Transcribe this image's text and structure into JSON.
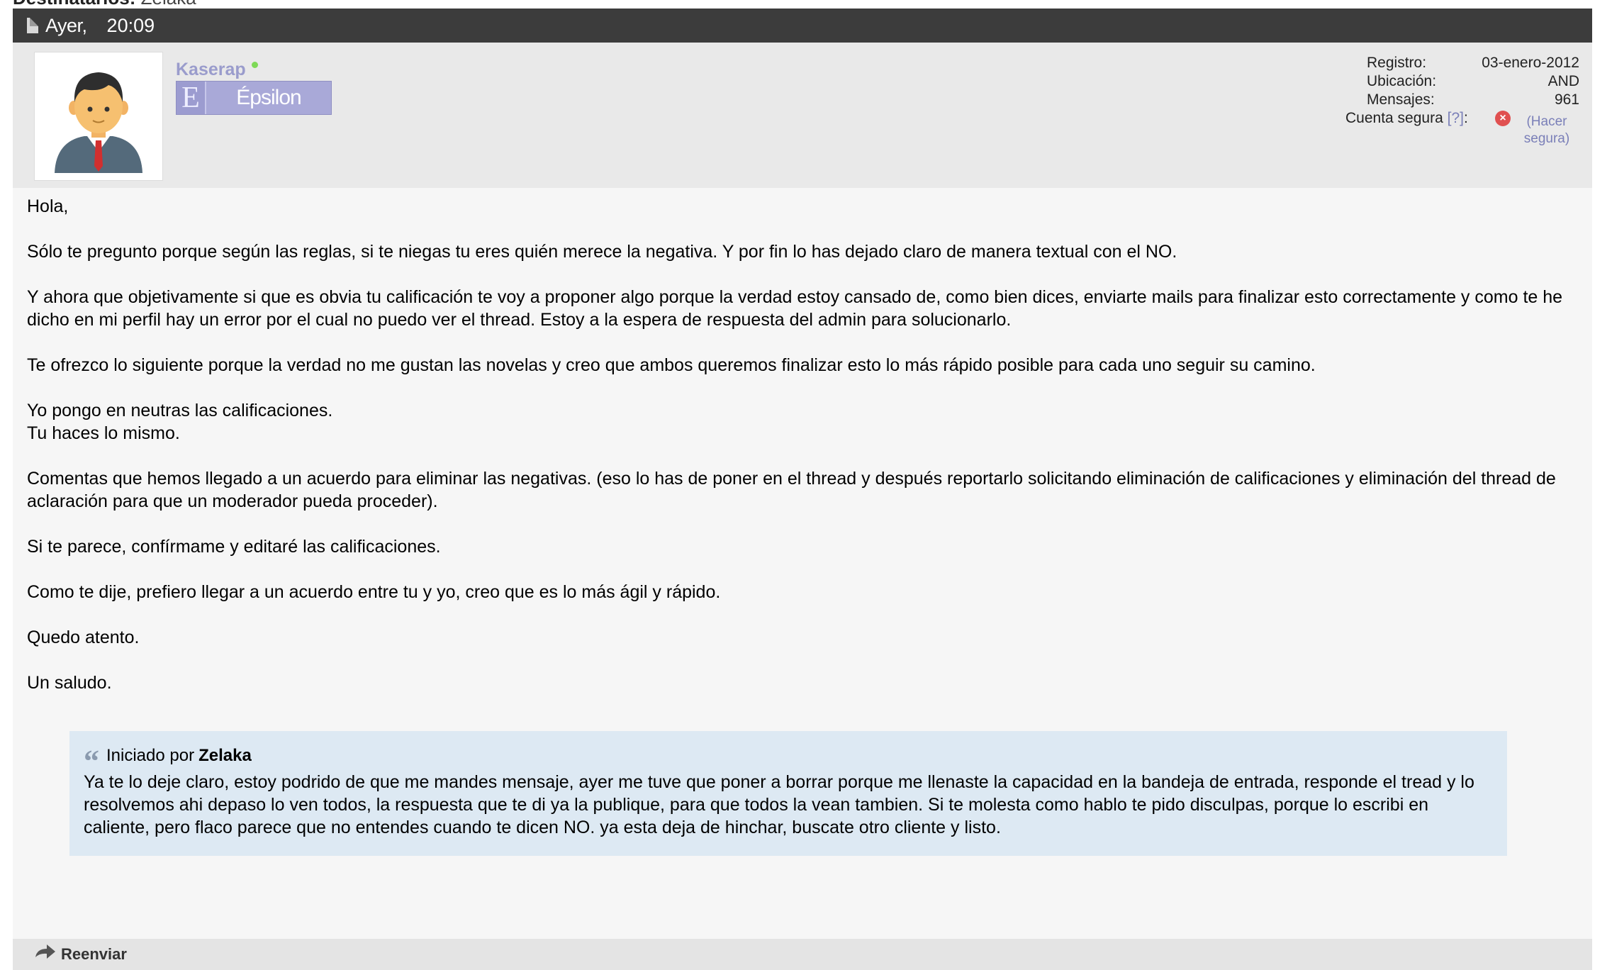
{
  "top": {
    "label": "Destinatarios:",
    "recipient": "Zelaka"
  },
  "header": {
    "date": "Ayer,",
    "time": "20:09"
  },
  "user": {
    "name": "Kaserap",
    "online_color": "#7ed957",
    "rank_letter": "E",
    "rank_name": "Épsilon",
    "avatar_icon": "user-avatar-icon"
  },
  "info": {
    "registro_label": "Registro:",
    "registro_value": "03-enero-2012",
    "ubicacion_label": "Ubicación:",
    "ubicacion_value": "AND",
    "mensajes_label": "Mensajes:",
    "mensajes_value": "961",
    "cuenta_label": "Cuenta segura",
    "cuenta_help": "[?]",
    "cuenta_colon": ":",
    "cuenta_link": "(Hacer segura)"
  },
  "message": {
    "p1": "Hola,",
    "p2": "Sólo te pregunto porque según las reglas, si te niegas tu eres quién merece la negativa. Y por fin lo has dejado claro de manera textual con el NO.",
    "p3": "Y ahora que objetivamente si que es obvia tu calificación te voy a proponer algo porque la verdad estoy cansado de, como bien dices, enviarte mails para finalizar esto correctamente y como te he dicho en mi perfil hay un error por el cual no puedo ver el thread. Estoy a la espera de respuesta del admin para solucionarlo.",
    "p4": "Te ofrezco lo siguiente porque la verdad no me gustan las novelas y creo que ambos queremos finalizar esto lo más rápido posible para cada uno seguir su camino.",
    "p5a": "Yo pongo en neutras las calificaciones.",
    "p5b": "Tu haces lo mismo.",
    "p6": "Comentas que hemos llegado a un acuerdo para eliminar las negativas. (eso lo has de poner en el thread y después reportarlo solicitando eliminación de calificaciones y eliminación del thread de aclaración para que un moderador pueda proceder).",
    "p7": "Si te parece, confírmame y editaré las calificaciones.",
    "p8": "Como te dije, prefiero llegar a un acuerdo entre tu y yo, creo que es lo más ágil y rápido.",
    "p9": "Quedo atento.",
    "p10": "Un saludo."
  },
  "quote": {
    "prefix": "Iniciado por",
    "author": "Zelaka",
    "text": "Ya te lo deje claro, estoy podrido de que me mandes mensaje, ayer me tuve que poner a borrar porque me llenaste la capacidad en la bandeja de entrada, responde el tread y lo resolvemos ahi depaso lo ven todos, la respuesta que te di ya la publique, para que todos la vean tambien. Si te molesta como hablo te pido disculpas, porque lo escribi en caliente, pero flaco parece que no entendes cuando te dicen NO. ya esta deja de hinchar, buscate otro cliente y listo."
  },
  "footer": {
    "forward_label": "Reenviar"
  }
}
